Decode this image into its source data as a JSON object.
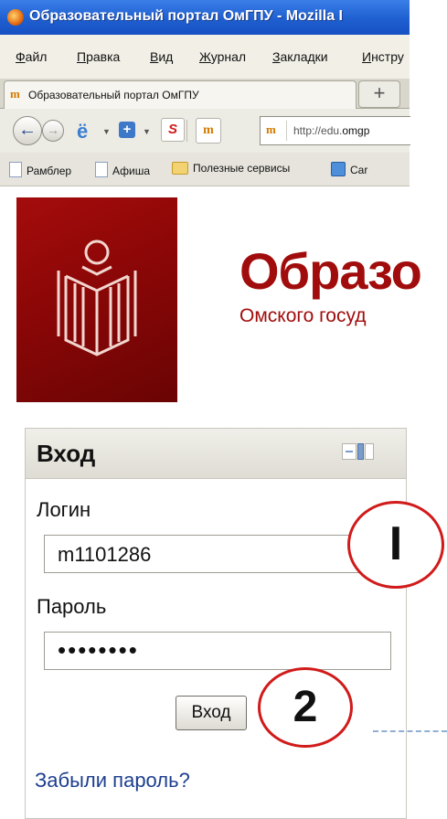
{
  "window": {
    "title": "Образовательный портал ОмГПУ - Mozilla I"
  },
  "menu": [
    {
      "label": "Файл",
      "u": "Ф",
      "rest": "айл"
    },
    {
      "label": "Правка",
      "u": "П",
      "rest": "равка"
    },
    {
      "label": "Вид",
      "u": "В",
      "rest": "ид"
    },
    {
      "label": "Журнал",
      "u": "Ж",
      "rest": "урнал"
    },
    {
      "label": "Закладки",
      "u": "З",
      "rest": "акладки"
    },
    {
      "label": "Инстру",
      "u": "И",
      "rest": "нстру"
    }
  ],
  "tab": {
    "title": "Образовательный портал ОмГПУ",
    "favicon": "m",
    "new_tab": "+"
  },
  "nav": {
    "url_prefix": "http://edu.",
    "url_domain": "omgp"
  },
  "bookmarks": [
    "Рамблер",
    "Афиша",
    "Полезные сервисы",
    "Car"
  ],
  "page": {
    "title": "Образо",
    "subtitle": "Омского госуд"
  },
  "login": {
    "heading": "Вход",
    "login_label": "Логин",
    "login_value": "m1101286",
    "password_label": "Пароль",
    "password_value": "••••••••",
    "submit_label": "Вход",
    "forgot_link": "Забыли пароль?"
  },
  "callouts": {
    "one": "I",
    "two": "2"
  },
  "colors": {
    "brand_red": "#a10c0c",
    "callout_border": "#d11a1a",
    "link_blue": "#1d3f8f"
  }
}
